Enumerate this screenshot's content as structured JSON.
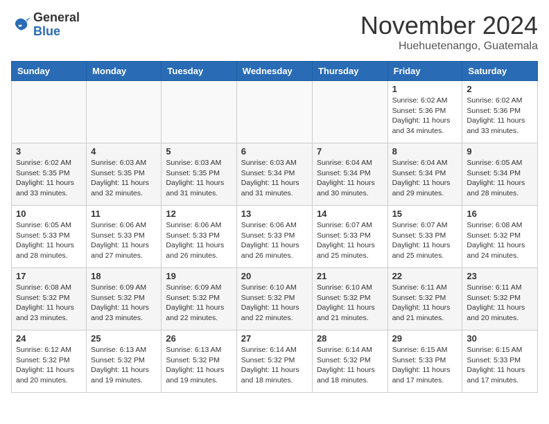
{
  "header": {
    "logo_general": "General",
    "logo_blue": "Blue",
    "month_title": "November 2024",
    "location": "Huehuetenango, Guatemala"
  },
  "weekdays": [
    "Sunday",
    "Monday",
    "Tuesday",
    "Wednesday",
    "Thursday",
    "Friday",
    "Saturday"
  ],
  "weeks": [
    [
      {
        "day": "",
        "info": ""
      },
      {
        "day": "",
        "info": ""
      },
      {
        "day": "",
        "info": ""
      },
      {
        "day": "",
        "info": ""
      },
      {
        "day": "",
        "info": ""
      },
      {
        "day": "1",
        "info": "Sunrise: 6:02 AM\nSunset: 5:36 PM\nDaylight: 11 hours\nand 34 minutes."
      },
      {
        "day": "2",
        "info": "Sunrise: 6:02 AM\nSunset: 5:36 PM\nDaylight: 11 hours\nand 33 minutes."
      }
    ],
    [
      {
        "day": "3",
        "info": "Sunrise: 6:02 AM\nSunset: 5:35 PM\nDaylight: 11 hours\nand 33 minutes."
      },
      {
        "day": "4",
        "info": "Sunrise: 6:03 AM\nSunset: 5:35 PM\nDaylight: 11 hours\nand 32 minutes."
      },
      {
        "day": "5",
        "info": "Sunrise: 6:03 AM\nSunset: 5:35 PM\nDaylight: 11 hours\nand 31 minutes."
      },
      {
        "day": "6",
        "info": "Sunrise: 6:03 AM\nSunset: 5:34 PM\nDaylight: 11 hours\nand 31 minutes."
      },
      {
        "day": "7",
        "info": "Sunrise: 6:04 AM\nSunset: 5:34 PM\nDaylight: 11 hours\nand 30 minutes."
      },
      {
        "day": "8",
        "info": "Sunrise: 6:04 AM\nSunset: 5:34 PM\nDaylight: 11 hours\nand 29 minutes."
      },
      {
        "day": "9",
        "info": "Sunrise: 6:05 AM\nSunset: 5:34 PM\nDaylight: 11 hours\nand 28 minutes."
      }
    ],
    [
      {
        "day": "10",
        "info": "Sunrise: 6:05 AM\nSunset: 5:33 PM\nDaylight: 11 hours\nand 28 minutes."
      },
      {
        "day": "11",
        "info": "Sunrise: 6:06 AM\nSunset: 5:33 PM\nDaylight: 11 hours\nand 27 minutes."
      },
      {
        "day": "12",
        "info": "Sunrise: 6:06 AM\nSunset: 5:33 PM\nDaylight: 11 hours\nand 26 minutes."
      },
      {
        "day": "13",
        "info": "Sunrise: 6:06 AM\nSunset: 5:33 PM\nDaylight: 11 hours\nand 26 minutes."
      },
      {
        "day": "14",
        "info": "Sunrise: 6:07 AM\nSunset: 5:33 PM\nDaylight: 11 hours\nand 25 minutes."
      },
      {
        "day": "15",
        "info": "Sunrise: 6:07 AM\nSunset: 5:33 PM\nDaylight: 11 hours\nand 25 minutes."
      },
      {
        "day": "16",
        "info": "Sunrise: 6:08 AM\nSunset: 5:32 PM\nDaylight: 11 hours\nand 24 minutes."
      }
    ],
    [
      {
        "day": "17",
        "info": "Sunrise: 6:08 AM\nSunset: 5:32 PM\nDaylight: 11 hours\nand 23 minutes."
      },
      {
        "day": "18",
        "info": "Sunrise: 6:09 AM\nSunset: 5:32 PM\nDaylight: 11 hours\nand 23 minutes."
      },
      {
        "day": "19",
        "info": "Sunrise: 6:09 AM\nSunset: 5:32 PM\nDaylight: 11 hours\nand 22 minutes."
      },
      {
        "day": "20",
        "info": "Sunrise: 6:10 AM\nSunset: 5:32 PM\nDaylight: 11 hours\nand 22 minutes."
      },
      {
        "day": "21",
        "info": "Sunrise: 6:10 AM\nSunset: 5:32 PM\nDaylight: 11 hours\nand 21 minutes."
      },
      {
        "day": "22",
        "info": "Sunrise: 6:11 AM\nSunset: 5:32 PM\nDaylight: 11 hours\nand 21 minutes."
      },
      {
        "day": "23",
        "info": "Sunrise: 6:11 AM\nSunset: 5:32 PM\nDaylight: 11 hours\nand 20 minutes."
      }
    ],
    [
      {
        "day": "24",
        "info": "Sunrise: 6:12 AM\nSunset: 5:32 PM\nDaylight: 11 hours\nand 20 minutes."
      },
      {
        "day": "25",
        "info": "Sunrise: 6:13 AM\nSunset: 5:32 PM\nDaylight: 11 hours\nand 19 minutes."
      },
      {
        "day": "26",
        "info": "Sunrise: 6:13 AM\nSunset: 5:32 PM\nDaylight: 11 hours\nand 19 minutes."
      },
      {
        "day": "27",
        "info": "Sunrise: 6:14 AM\nSunset: 5:32 PM\nDaylight: 11 hours\nand 18 minutes."
      },
      {
        "day": "28",
        "info": "Sunrise: 6:14 AM\nSunset: 5:32 PM\nDaylight: 11 hours\nand 18 minutes."
      },
      {
        "day": "29",
        "info": "Sunrise: 6:15 AM\nSunset: 5:33 PM\nDaylight: 11 hours\nand 17 minutes."
      },
      {
        "day": "30",
        "info": "Sunrise: 6:15 AM\nSunset: 5:33 PM\nDaylight: 11 hours\nand 17 minutes."
      }
    ]
  ]
}
